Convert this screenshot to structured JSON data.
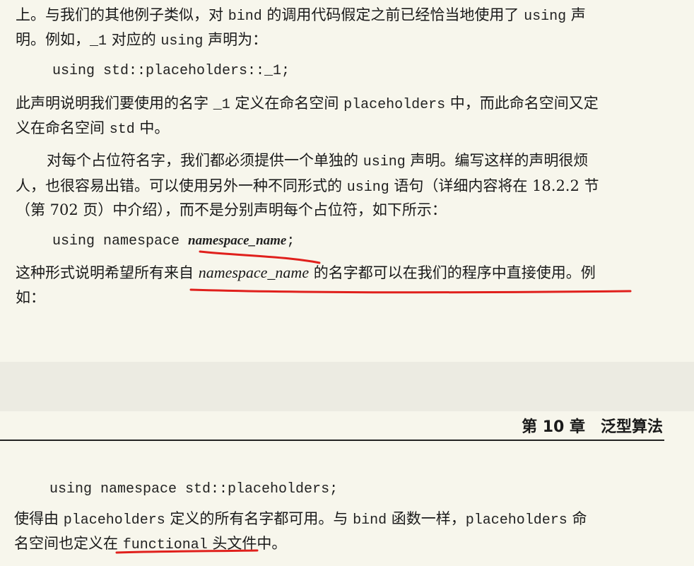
{
  "top": {
    "p1": {
      "l1a": "上。与我们的其他例子类似，对 ",
      "l1b": "bind",
      "l1c": " 的调用代码假定之前已经恰当地使用了 ",
      "l1d": "using",
      "l1e": " 声",
      "l2a": "明。例如，",
      "l2b": "_1",
      "l2c": " 对应的 ",
      "l2d": "using",
      "l2e": " 声明为："
    },
    "code1": "using std::placeholders::_1;",
    "p2": {
      "l1a": "此声明说明我们要使用的名字 ",
      "l1b": "_1",
      "l1c": " 定义在命名空间 ",
      "l1d": "placeholders",
      "l1e": " 中，而此命名空间又定",
      "l2a": "义在命名空间 ",
      "l2b": "std",
      "l2c": " 中。"
    },
    "p3": {
      "l1a": "对每个占位符名字，我们都必须提供一个单独的 ",
      "l1b": "using",
      "l1c": " 声明。编写这样的声明很烦",
      "l2a": "人，也很容易出错。可以使用另外一种不同形式的 ",
      "l2b": "using",
      "l2c": " 语句（详细内容将在 18.2.2 节",
      "l3": "（第 702 页）中介绍），而不是分别声明每个占位符，如下所示："
    },
    "code2": {
      "a": "using namespace ",
      "b": "namespace_name",
      "c": ";"
    },
    "p4": {
      "l1a": "这种形式说明希望所有来自 ",
      "l1b": "namespace_name",
      "l1c": " 的名字都可以在我们的程序中直接使用。例",
      "l2": "如："
    }
  },
  "header": {
    "chapter": "第 10 章　泛型算法"
  },
  "bottom": {
    "code3": "using namespace std::placeholders;",
    "p5": {
      "l1a": "使得由 ",
      "l1b": "placeholders",
      "l1c": " 定义的所有名字都可用。与 ",
      "l1d": "bind",
      "l1e": " 函数一样，",
      "l1f": "placeholders",
      "l1g": " 命",
      "l2a": "名空间也定义在 ",
      "l2b": "functional",
      "l2c": " 头文件中。"
    }
  },
  "colors": {
    "paper": "#f7f6ec",
    "ink": "#1a1a1a",
    "annotation": "#e0201c"
  }
}
